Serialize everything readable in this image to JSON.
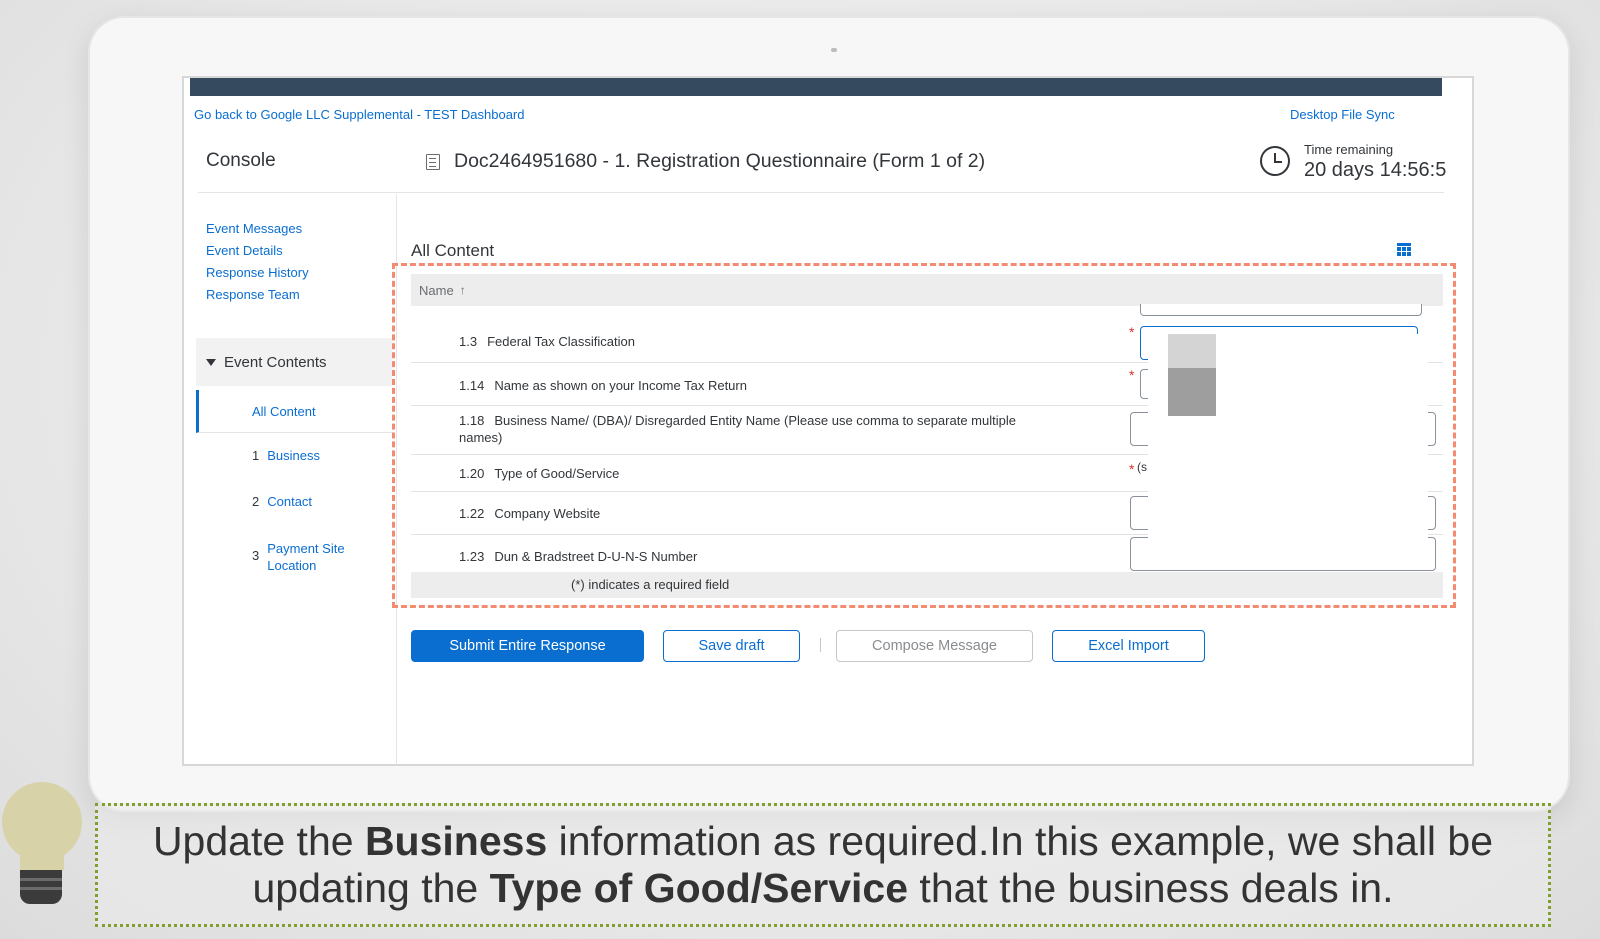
{
  "header": {
    "back_link": "Go back to Google LLC Supplemental - TEST Dashboard",
    "desktop_sync": "Desktop File Sync",
    "console_title": "Console",
    "document_title": "Doc2464951680 - 1. Registration Questionnaire (Form 1 of 2)",
    "time_remaining_label": "Time remaining",
    "time_remaining_value": "20 days 14:56:5"
  },
  "sidebar": {
    "links": [
      "Event Messages",
      "Event Details",
      "Response History",
      "Response Team"
    ],
    "event_contents_label": "Event Contents",
    "all_content_label": "All Content",
    "items": [
      {
        "num": "1",
        "label": "Business"
      },
      {
        "num": "2",
        "label": "Contact"
      },
      {
        "num": "3",
        "label": "Payment Site Location"
      }
    ]
  },
  "main": {
    "section_title": "All Content",
    "table_header": "Name",
    "rows": [
      {
        "num": "1.3",
        "label": "Federal Tax Classification",
        "required": true
      },
      {
        "num": "1.14",
        "label": "Name as shown on your Income Tax Return",
        "required": true
      },
      {
        "num": "1.18",
        "label": "Business Name/ (DBA)/ Disregarded Entity Name (Please use comma to separate multiple names)",
        "required": false
      },
      {
        "num": "1.20",
        "label": "Type of Good/Service",
        "required": true,
        "fragment": "(s"
      },
      {
        "num": "1.22",
        "label": "Company Website",
        "required": false
      },
      {
        "num": "1.23",
        "label": "Dun & Bradstreet D-U-N-S Number",
        "required": false
      }
    ],
    "required_note": "(*) indicates a required field",
    "required_marker": "*"
  },
  "actions": {
    "submit": "Submit Entire Response",
    "save_draft": "Save draft",
    "compose": "Compose Message",
    "excel_import": "Excel Import"
  },
  "caption": {
    "p1": "Update the ",
    "b1": "Business",
    "p2": " information as required.In this example, we shall be updating the ",
    "b2": "Type of Good/Service",
    "p3": " that the business deals in."
  },
  "colors": {
    "accent": "#0a6ed1",
    "topbar": "#354a5f",
    "required": "#e0342b",
    "highlight": "#f28b70",
    "caption_border": "#7fa02e"
  }
}
